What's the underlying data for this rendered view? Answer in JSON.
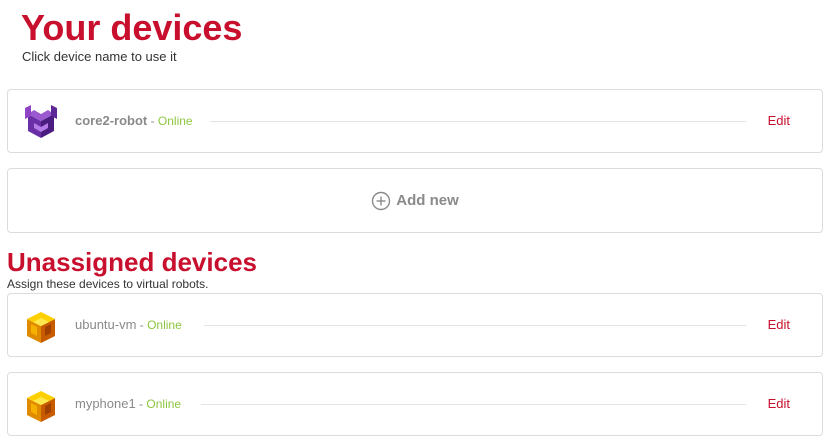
{
  "your_devices": {
    "title": "Your devices",
    "subtitle": "Click device name to use it",
    "devices": [
      {
        "name": "core2-robot",
        "separator": " - ",
        "status": "Online",
        "edit_label": "Edit",
        "icon": "purple-cube-icon"
      }
    ],
    "add_label": "Add new"
  },
  "unassigned_devices": {
    "title": "Unassigned devices",
    "subtitle": "Assign these devices to virtual robots.",
    "devices": [
      {
        "name": "ubuntu-vm",
        "separator": " - ",
        "status": "Online",
        "edit_label": "Edit",
        "icon": "yellow-cube-icon"
      },
      {
        "name": "myphone1",
        "separator": " - ",
        "status": "Online",
        "edit_label": "Edit",
        "icon": "yellow-cube-icon"
      }
    ]
  },
  "colors": {
    "accent": "#c8102e",
    "online": "#8ec641",
    "muted_text": "#8a8a8a",
    "border": "#dcdcdc"
  }
}
